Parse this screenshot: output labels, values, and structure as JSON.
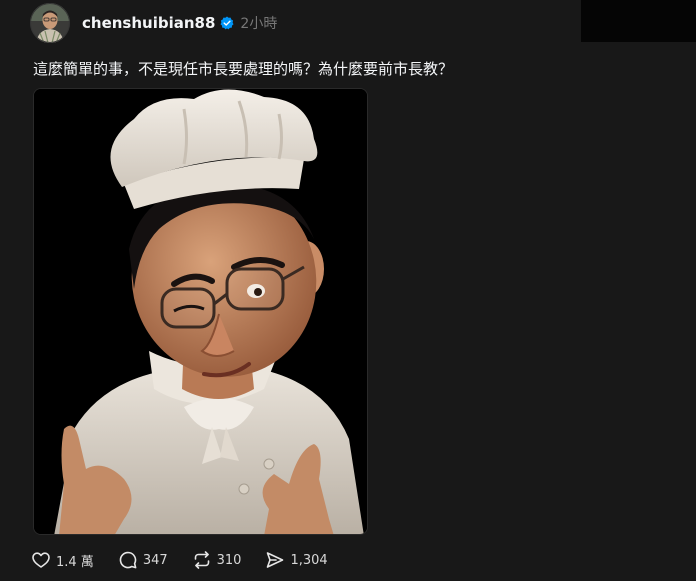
{
  "post": {
    "author": {
      "username": "chenshuibian88",
      "verified": true,
      "avatar_icon": "avatar-photo-icon"
    },
    "timestamp": "2小時",
    "text": "這麼簡單的事，不是現任市長要處理的嗎？為什麼要前市長教？",
    "image": {
      "description_icon": "cartoon-chef-image"
    },
    "actions": {
      "likes": {
        "icon": "heart-icon",
        "count": "1.4 萬"
      },
      "replies": {
        "icon": "comment-icon",
        "count": "347"
      },
      "reposts": {
        "icon": "repost-icon",
        "count": "310"
      },
      "shares": {
        "icon": "share-icon",
        "count": "1,304"
      }
    }
  },
  "colors": {
    "background": "#181818",
    "text": "#f3f5f7",
    "muted": "#777777",
    "verified_blue": "#0095f6"
  }
}
